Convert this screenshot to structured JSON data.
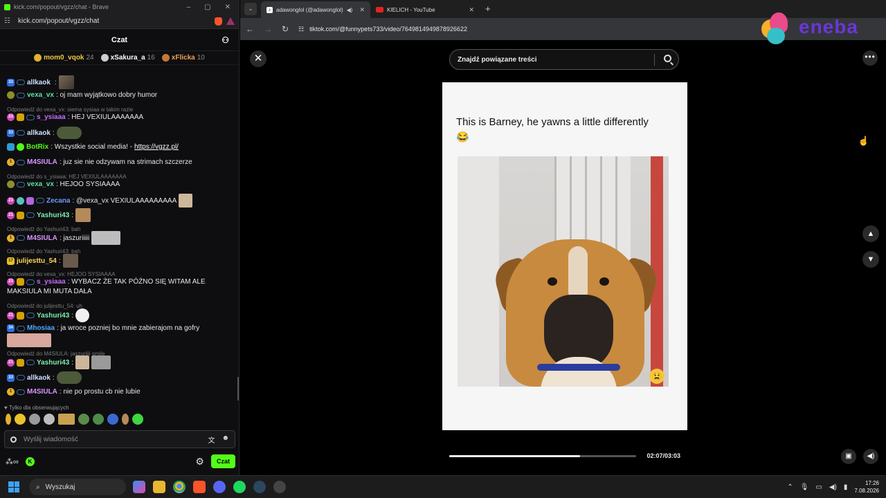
{
  "brave": {
    "title": "kick.com/popout/vgzz/chat - Brave",
    "url": "kick.com/popout/vgzz/chat"
  },
  "chat": {
    "header": "Czat",
    "leaderboard": [
      {
        "name": "mom0_vqok",
        "count": "24",
        "color": "#f4c542",
        "medal": "#e3b12a"
      },
      {
        "name": "xSakura_a",
        "count": "16",
        "color": "#ffffff",
        "medal": "#cfcfcf"
      },
      {
        "name": "xFlicka",
        "count": "10",
        "color": "#f0a050",
        "medal": "#c47a35"
      }
    ],
    "messages": [
      {
        "user": "allkaok",
        "color": "#cfe0ff",
        "text": ""
      },
      {
        "user": "vexa_vx",
        "color": "#5fe0a8",
        "text": ": oj mam wyjątkowo dobry humor"
      },
      {
        "reply": "Odpowiedź do vexa_vx: siema sysiaa w takim razie"
      },
      {
        "user": "s_ysiaaa",
        "color": "#c56bff",
        "text": ": HEJ VEXIULAAAAAAA"
      },
      {
        "user": "allkaok",
        "color": "#cfe0ff",
        "text": ""
      },
      {
        "user": "BotRix",
        "color": "#53fc18",
        "text": ": Wszystkie social media! - ",
        "link": "https://vgzz.pl/"
      },
      {
        "user": "M4SIULA",
        "color": "#d896ff",
        "text": ": juz sie nie odzywam na strimach szczerze"
      },
      {
        "reply": "Odpowiedź do s_ysiaaa: HEJ VEXIULAAAAAAA"
      },
      {
        "user": "vexa_vx",
        "color": "#5fe0a8",
        "text": ": HEJOO SYSIAAAA"
      },
      {
        "user": "Zecana",
        "color": "#6b9cff",
        "text": ": @vexa_vx VEXIULAAAAAAAAA"
      },
      {
        "user": "Yashuri43",
        "color": "#7df0b0",
        "text": ":"
      },
      {
        "reply": "Odpowiedź do Yashuri43: bah"
      },
      {
        "user": "M4SIULA",
        "color": "#d896ff",
        "text": ": jaszuriiiii"
      },
      {
        "reply": "Odpowiedź do Yashuri43: bah"
      },
      {
        "user": "julijesttu_54",
        "color": "#ffd75a",
        "text": ":"
      },
      {
        "reply": "Odpowiedź do vexa_vx: HEJOO SYSIAAAA"
      },
      {
        "user": "s_ysiaaa",
        "color": "#c56bff",
        "text": ": WYBACZ ŻE TAK PÓŹNO SIĘ WITAM ALE"
      },
      {
        "continuation": "MAKSIULA MI MUTA DAŁA"
      },
      {
        "reply": "Odpowiedź do julijesttu_54: uh"
      },
      {
        "user": "Yashuri43",
        "color": "#7df0b0",
        "text": ":"
      },
      {
        "user": "Mhosiaa",
        "color": "#4fa8ff",
        "text": ": ja wroce pozniej bo mnie zabierajom na gofry"
      },
      {
        "reply": "Odpowiedź do M4SIULA: jaszuriiii smile"
      },
      {
        "user": "Yashuri43",
        "color": "#7df0b0",
        "text": ":"
      },
      {
        "user": "allkaok",
        "color": "#cfe0ff",
        "text": ":"
      },
      {
        "user": "M4SIULA",
        "color": "#d896ff",
        "text": ": nie po prostu cb nie lubie"
      }
    ],
    "followers_only": "Tylko dla obserwujących",
    "input_placeholder": "Wyślij wiadomość",
    "send_label": "Czat"
  },
  "chrome": {
    "tabs": [
      {
        "title": "adawonglol (@adawonglol)",
        "active": true
      },
      {
        "title": "KIELICH - YouTube",
        "active": false
      }
    ],
    "url": "tiktok.com/@funnypets733/video/7649814949878926622"
  },
  "tiktok": {
    "search_placeholder": "Znajdź powiązane treści",
    "caption": "This is Barney, he yawns a little differently 😂",
    "progress": 0.7,
    "timecode": "02:07/03:03"
  },
  "ad": {
    "brand": "eneba"
  },
  "taskbar": {
    "search_label": "Wyszukaj",
    "time": "17:26",
    "date": "7.08.2026"
  }
}
